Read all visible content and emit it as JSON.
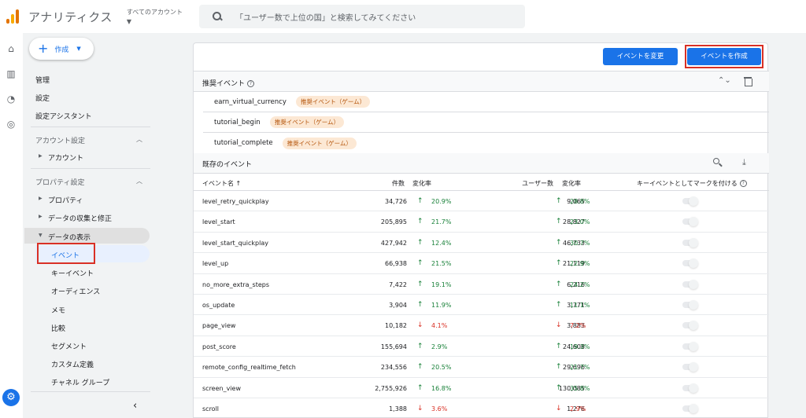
{
  "header": {
    "app_title": "アナリティクス",
    "account_label": "すべてのアカウント",
    "search_placeholder": "「ユーザー数で上位の国」と検索してみてください"
  },
  "sidenav": {
    "create_label": "作成",
    "items": {
      "admin": "管理",
      "settings": "設定",
      "setup_assistant": "設定アシスタント",
      "account_settings": "アカウント設定",
      "account": "アカウント",
      "property_settings": "プロパティ設定",
      "property": "プロパティ",
      "data_collection": "データの収集と修正",
      "data_display": "データの表示",
      "events": "イベント",
      "key_events": "キーイベント",
      "audiences": "オーディエンス",
      "memo": "メモ",
      "comparison": "比較",
      "segments": "セグメント",
      "custom_definitions": "カスタム定義",
      "channel_groups": "チャネル グループ"
    }
  },
  "toolbar": {
    "change_event": "イベントを変更",
    "create_event": "イベントを作成"
  },
  "recommended": {
    "title": "推奨イベント",
    "items": [
      {
        "name": "earn_virtual_currency",
        "chip": "推奨イベント（ゲーム）"
      },
      {
        "name": "tutorial_begin",
        "chip": "推奨イベント（ゲーム）"
      },
      {
        "name": "tutorial_complete",
        "chip": "推奨イベント（ゲーム）"
      }
    ]
  },
  "existing": {
    "title": "既存のイベント",
    "columns": {
      "name": "イベント名 ↑",
      "count": "件数",
      "rate1": "変化率",
      "users": "ユーザー数",
      "rate2": "変化率",
      "mark": "キーイベントとしてマークを付ける"
    },
    "rows": [
      {
        "name": "level_retry_quickplay",
        "count": "34,726",
        "dir1": "up",
        "rate1": "20.9%",
        "users": "9,065",
        "dir2": "up",
        "rate2": "28.8%"
      },
      {
        "name": "level_start",
        "count": "205,895",
        "dir1": "up",
        "rate1": "21.7%",
        "users": "28,827",
        "dir2": "up",
        "rate2": "23.0%"
      },
      {
        "name": "level_start_quickplay",
        "count": "427,942",
        "dir1": "up",
        "rate1": "12.4%",
        "users": "46,733",
        "dir2": "up",
        "rate2": "30.7%"
      },
      {
        "name": "level_up",
        "count": "66,938",
        "dir1": "up",
        "rate1": "21.5%",
        "users": "21,119",
        "dir2": "up",
        "rate2": "22.9%"
      },
      {
        "name": "no_more_extra_steps",
        "count": "7,422",
        "dir1": "up",
        "rate1": "19.1%",
        "users": "6,216",
        "dir2": "up",
        "rate2": "24.2%"
      },
      {
        "name": "os_update",
        "count": "3,904",
        "dir1": "up",
        "rate1": "11.9%",
        "users": "3,771",
        "dir2": "up",
        "rate2": "11.1%"
      },
      {
        "name": "page_view",
        "count": "10,182",
        "dir1": "down",
        "rate1": "4.1%",
        "users": "3,883",
        "dir2": "down",
        "rate2": "7.2%"
      },
      {
        "name": "post_score",
        "count": "155,694",
        "dir1": "up",
        "rate1": "2.9%",
        "users": "24,608",
        "dir2": "up",
        "rate2": "19.3%"
      },
      {
        "name": "remote_config_realtime_fetch",
        "count": "234,556",
        "dir1": "up",
        "rate1": "20.5%",
        "users": "29,696",
        "dir2": "up",
        "rate2": "21.7%"
      },
      {
        "name": "screen_view",
        "count": "2,755,926",
        "dir1": "up",
        "rate1": "16.8%",
        "users": "130,085",
        "dir2": "up",
        "rate2": "35.8%"
      },
      {
        "name": "scroll",
        "count": "1,388",
        "dir1": "down",
        "rate1": "3.6%",
        "users": "1,276",
        "dir2": "down",
        "rate2": "2.9%"
      }
    ]
  },
  "colors": {
    "accent": "#1a73e8",
    "up": "#188038",
    "down": "#d93025",
    "highlight": "#d93025"
  }
}
